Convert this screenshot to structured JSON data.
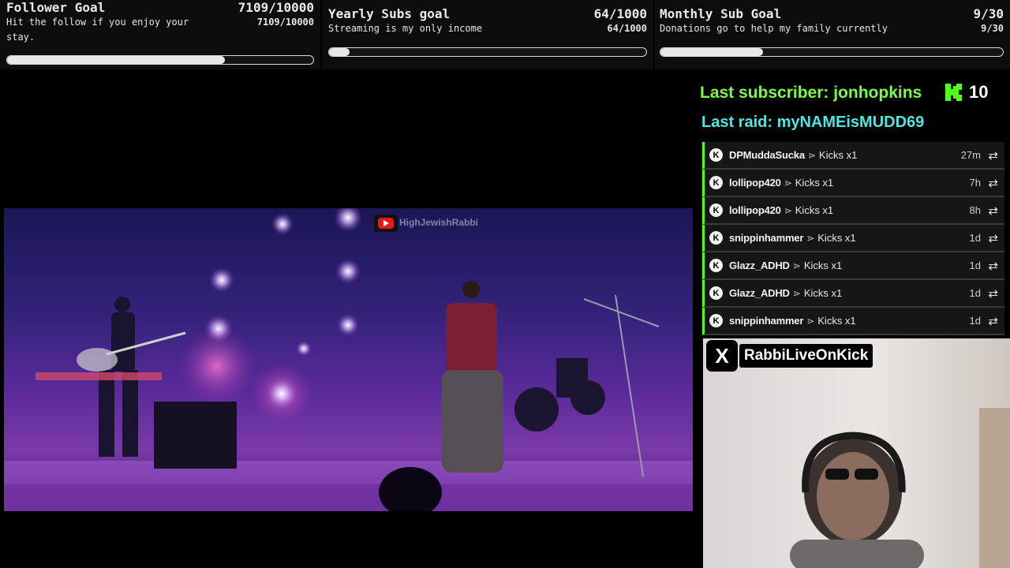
{
  "goals": [
    {
      "title": "Follower Goal",
      "count": "7109/10000",
      "description": "Hit the follow if you enjoy your stay.",
      "progress": 0.711
    },
    {
      "title": "Yearly Subs goal",
      "count": "64/1000",
      "description": "Streaming is my only income",
      "progress": 0.064
    },
    {
      "title": "Monthly Sub Goal",
      "count": "9/30",
      "description": "Donations go to help my family currently",
      "progress": 0.3
    }
  ],
  "last_subscriber": "Last subscriber: jonhopkins",
  "kick_count": "10",
  "last_raid": "Last raid: myNAMEisMUDD69",
  "events": [
    {
      "user": "DPMuddaSucka",
      "sep": "⋗",
      "what": "Kicks x1",
      "time": "27m"
    },
    {
      "user": "lollipop420",
      "sep": "⋗",
      "what": "Kicks x1",
      "time": "7h"
    },
    {
      "user": "lollipop420",
      "sep": "⋗",
      "what": "Kicks x1",
      "time": "8h"
    },
    {
      "user": "snippinhammer",
      "sep": "⋗",
      "what": "Kicks x1",
      "time": "1d"
    },
    {
      "user": "Glazz_ADHD",
      "sep": "⋗",
      "what": "Kicks x1",
      "time": "1d"
    },
    {
      "user": "Glazz_ADHD",
      "sep": "⋗",
      "what": "Kicks x1",
      "time": "1d"
    },
    {
      "user": "snippinhammer",
      "sep": "⋗",
      "what": "Kicks x1",
      "time": "1d"
    }
  ],
  "event_icon": "K",
  "repeat_icon": "⇄",
  "video_watermark": "HighJewishRabbi",
  "social_icon": "X",
  "social_handle": "RabbiLiveOnKick",
  "colors": {
    "kick_green": "#53fc18",
    "sub_green": "#7CFC4A",
    "raid_cyan": "#4ee6e0"
  }
}
